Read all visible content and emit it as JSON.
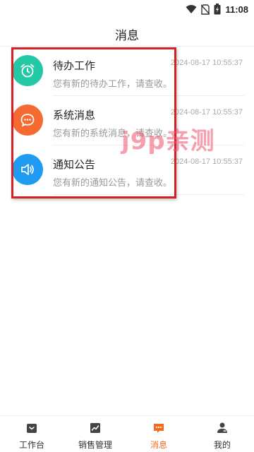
{
  "status_bar": {
    "time": "11:08"
  },
  "header": {
    "title": "消息"
  },
  "messages": [
    {
      "title": "待办工作",
      "subtitle": "您有新的待办工作，请查收。",
      "time": "2024-08-17 10:55:37",
      "icon": "alarm-clock-icon",
      "color": "#23c9a4"
    },
    {
      "title": "系统消息",
      "subtitle": "您有新的系统消息，请查收。",
      "time": "2024-08-17 10:55:37",
      "icon": "chat-bubble-icon",
      "color": "#f56a32"
    },
    {
      "title": "通知公告",
      "subtitle": "您有新的通知公告，请查收。",
      "time": "2024-08-17 10:55:37",
      "icon": "megaphone-icon",
      "color": "#1f9bf1"
    }
  ],
  "watermark": "j9p亲测",
  "tab_bar": {
    "active_color": "#f46b1f",
    "tabs": [
      {
        "label": "工作台",
        "icon": "briefcase-icon"
      },
      {
        "label": "销售管理",
        "icon": "chart-icon"
      },
      {
        "label": "消息",
        "icon": "message-icon",
        "active": true
      },
      {
        "label": "我的",
        "icon": "user-icon"
      }
    ]
  }
}
